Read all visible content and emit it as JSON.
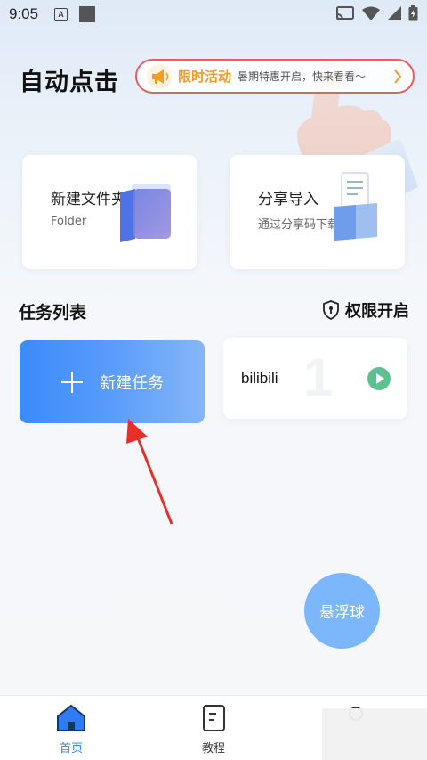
{
  "status_bar": {
    "time": "9:05",
    "a_badge": "A"
  },
  "header": {
    "title": "自动点击"
  },
  "promo": {
    "tag": "限时活动",
    "text": "暑期特惠开启，快来看看～"
  },
  "cards": [
    {
      "title": "新建文件夹",
      "subtitle": "Folder"
    },
    {
      "title": "分享导入",
      "subtitle": "通过分享码下载"
    }
  ],
  "tasks": {
    "section_title": "任务列表",
    "permission_label": "权限开启",
    "new_task_label": "新建任务",
    "items": [
      {
        "name": "bilibili",
        "index": "1"
      }
    ]
  },
  "float_ball": {
    "label": "悬浮球"
  },
  "bottom_nav": {
    "items": [
      {
        "label": "首页",
        "active": true
      },
      {
        "label": "教程",
        "active": false
      }
    ]
  },
  "colors": {
    "accent": "#2d7cf6",
    "promo_border": "#f05a5a",
    "promo_tag": "#f59a23",
    "play": "#5cc18f",
    "annotation": "#e8302a"
  }
}
